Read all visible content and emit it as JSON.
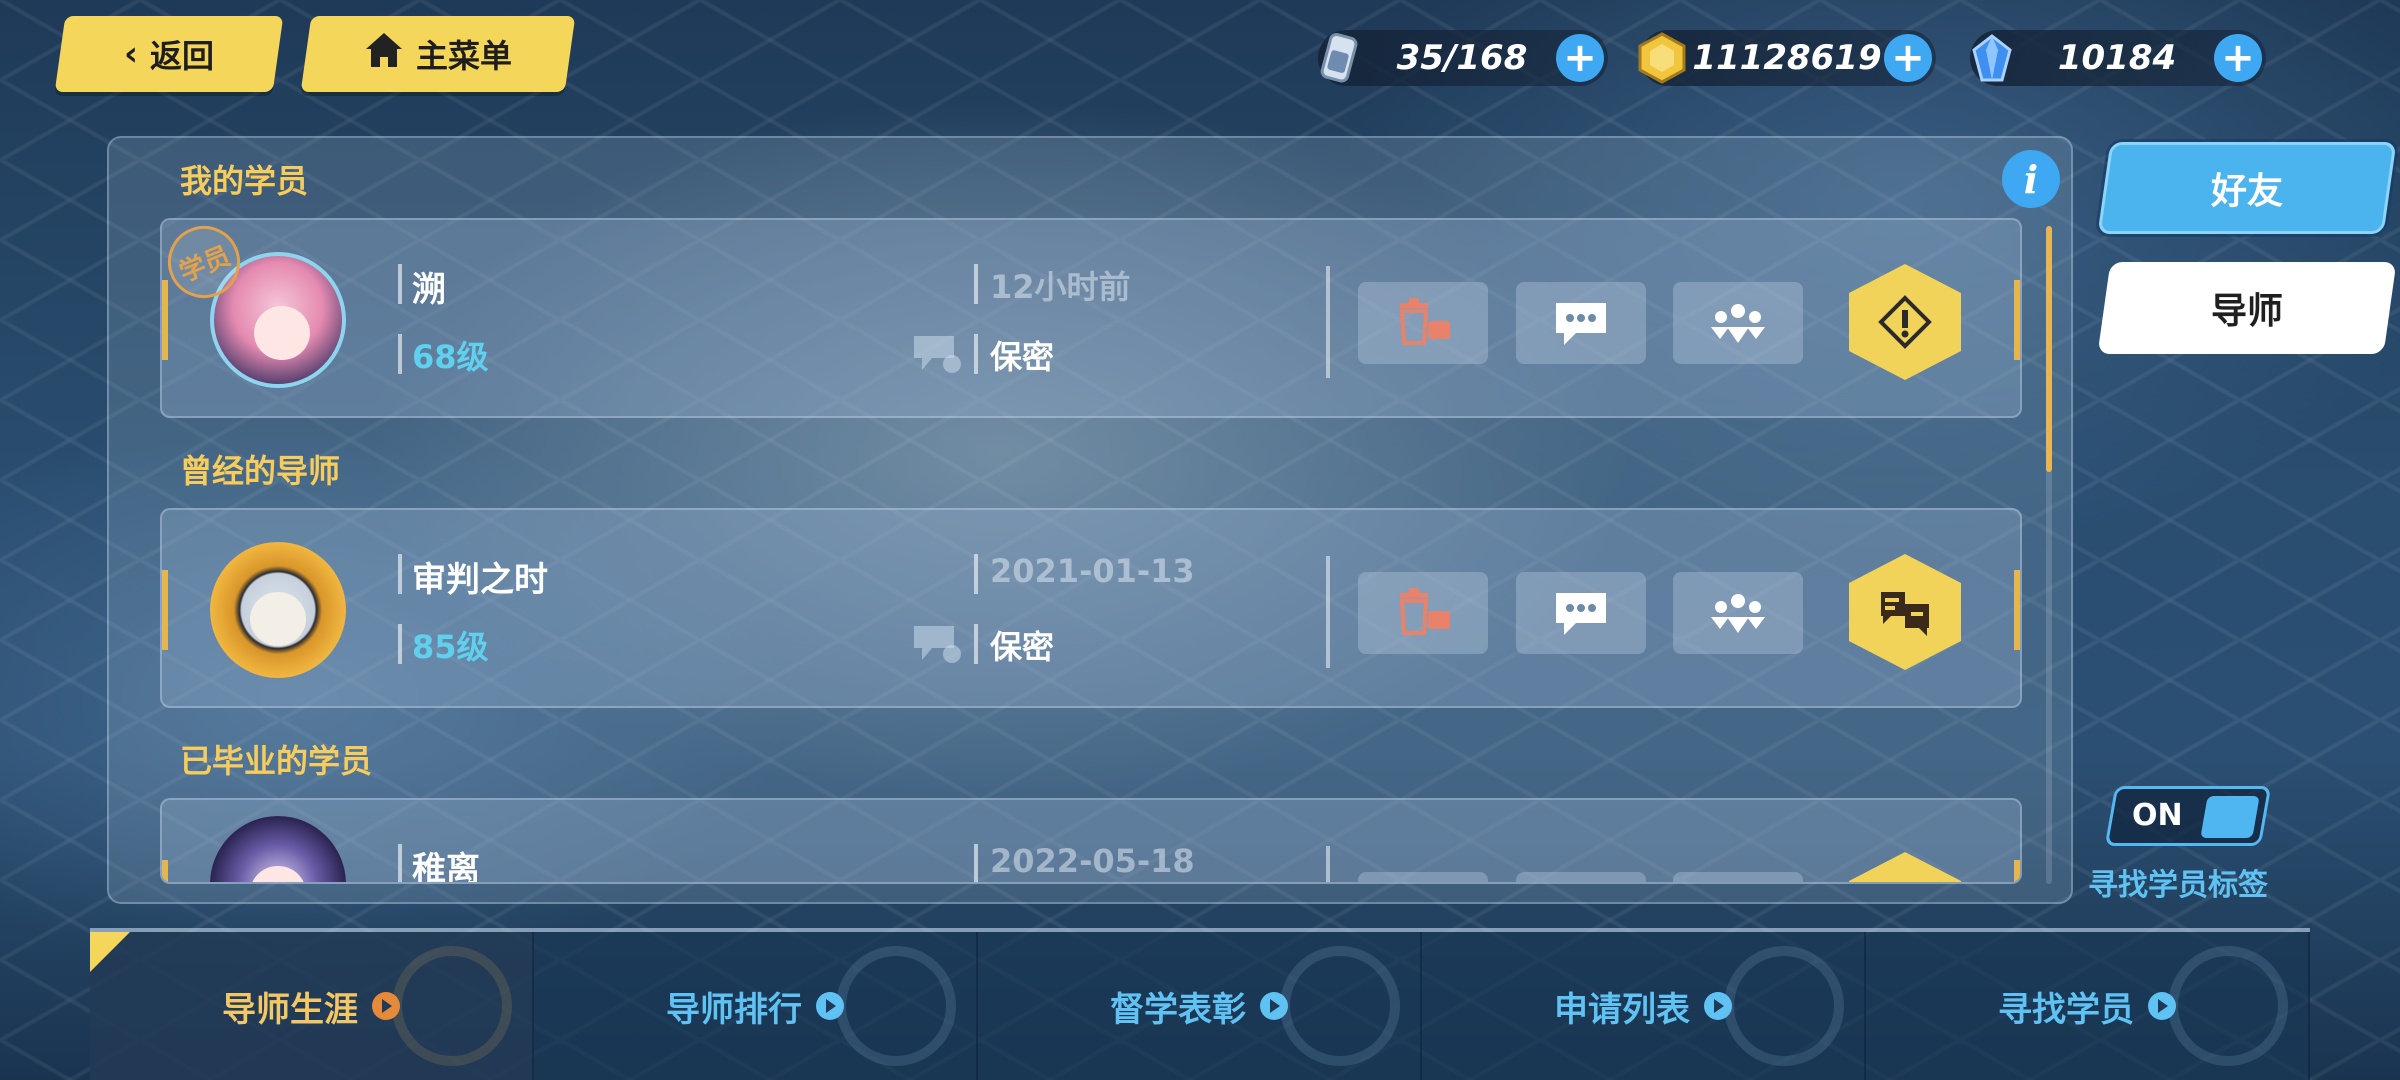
{
  "top": {
    "back_label": "返回",
    "menu_label": "主菜单"
  },
  "resources": [
    {
      "icon": "stamina-icon",
      "value": "35/168"
    },
    {
      "icon": "coin-icon",
      "value": "11128619"
    },
    {
      "icon": "crystal-icon",
      "value": "10184"
    }
  ],
  "sections": {
    "my_students": "我的学员",
    "former_mentors": "曾经的导师",
    "graduated_students": "已毕业的学员"
  },
  "cards": [
    {
      "name": "溯",
      "level": "68级",
      "time": "12小时前",
      "privacy": "保密",
      "badge": "学员"
    },
    {
      "name": "审判之时",
      "level": "85级",
      "time": "2021-01-13",
      "privacy": "保密"
    },
    {
      "name": "稚离",
      "time": "2022-05-18"
    }
  ],
  "side_tabs": {
    "friends": "好友",
    "mentor": "导师"
  },
  "toggle": {
    "state": "ON",
    "label": "寻找学员标签"
  },
  "bottom_nav": [
    {
      "label": "导师生涯",
      "active": true
    },
    {
      "label": "导师排行"
    },
    {
      "label": "督学表彰"
    },
    {
      "label": "申请列表"
    },
    {
      "label": "寻找学员"
    }
  ],
  "colors": {
    "accent_yellow": "#f3d65a",
    "accent_blue": "#4bb4ef",
    "section_gold": "#f6cd5d",
    "level_cyan": "#5fd0ee"
  }
}
